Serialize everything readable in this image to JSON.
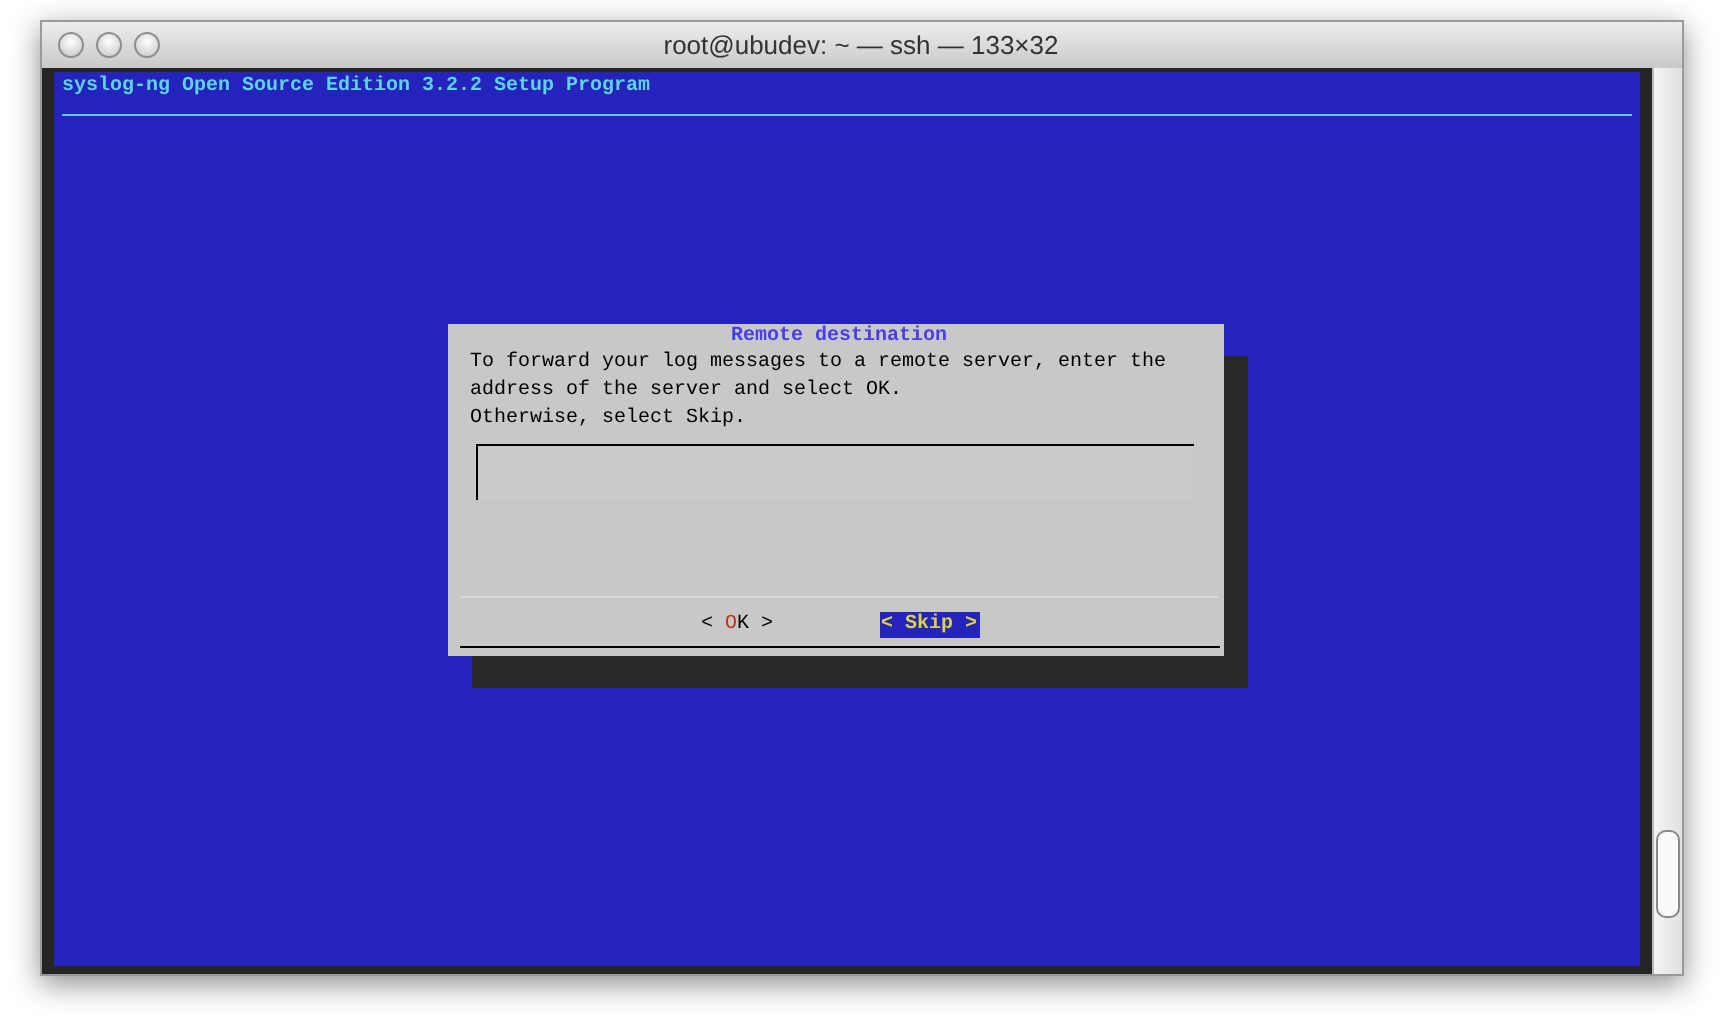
{
  "window": {
    "title": "root@ubudev: ~ — ssh — 133×32"
  },
  "header": {
    "title": "syslog-ng Open Source Edition 3.2.2 Setup Program"
  },
  "dialog": {
    "title": "Remote destination",
    "message": [
      "To forward your log messages to a remote server, enter the",
      "address of the server and select OK.",
      "Otherwise, select Skip."
    ],
    "buttons": [
      {
        "left": "<",
        "hotkey": "O",
        "rest": "K",
        "right": ">",
        "selected": false
      },
      {
        "left": "<",
        "hotkey": "S",
        "rest": "kip",
        "right": ">",
        "selected": true
      }
    ]
  }
}
